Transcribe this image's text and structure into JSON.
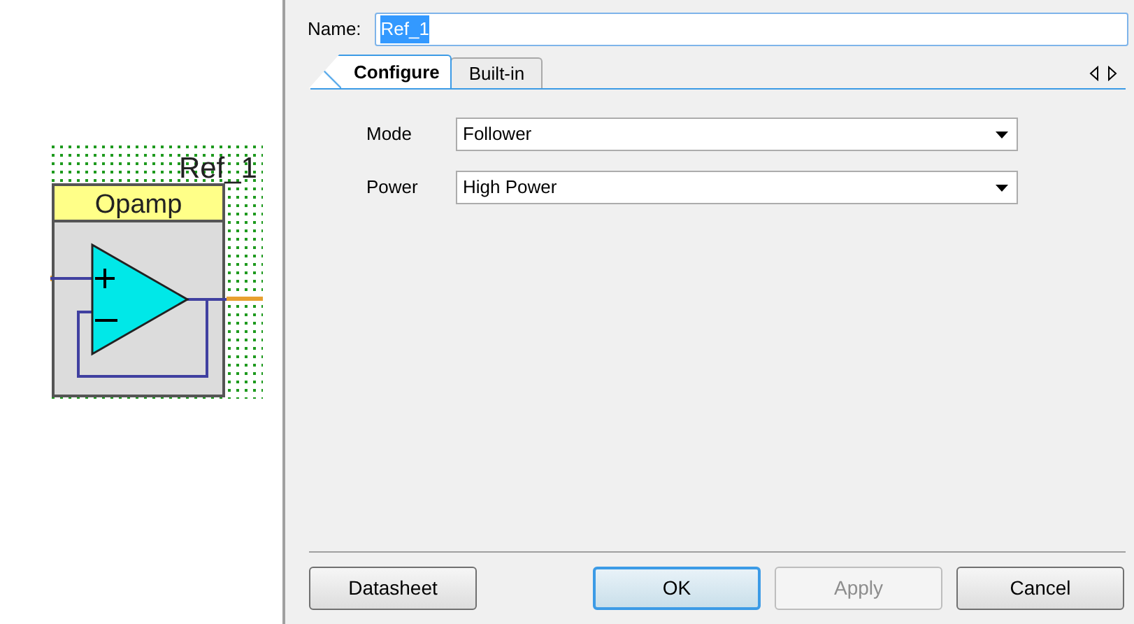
{
  "schematic": {
    "instance_name": "Ref_1",
    "component_title": "Opamp"
  },
  "dialog": {
    "name_label": "Name:",
    "name_value": "Ref_1",
    "name_text_selected": true,
    "tabs": [
      {
        "label": "Configure",
        "selected": true
      },
      {
        "label": "Built-in",
        "selected": false
      }
    ],
    "fields": [
      {
        "label": "Mode",
        "value": "Follower"
      },
      {
        "label": "Power",
        "value": "High Power"
      }
    ],
    "buttons": [
      {
        "label": "Datasheet",
        "kind": "plain",
        "disabled": false
      },
      {
        "label": "OK",
        "kind": "default",
        "disabled": false
      },
      {
        "label": "Apply",
        "kind": "plain",
        "disabled": true
      },
      {
        "label": "Cancel",
        "kind": "plain",
        "disabled": false
      }
    ]
  }
}
